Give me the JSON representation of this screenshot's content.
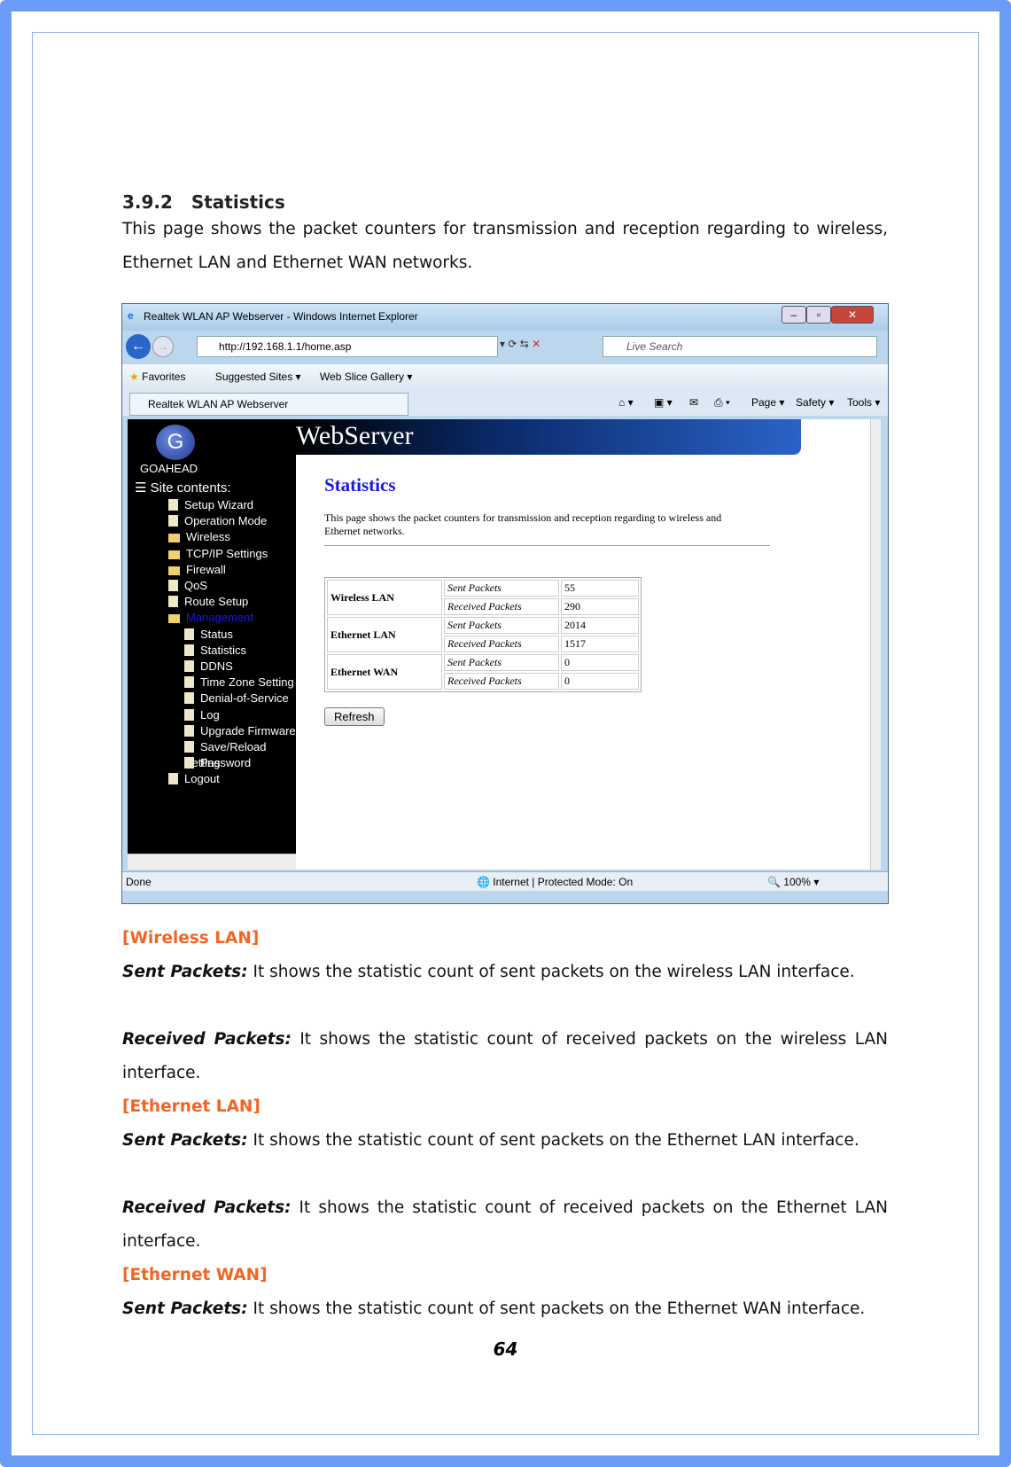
{
  "section": {
    "number": "3.9.2",
    "title": "Statistics",
    "intro": "This page shows the packet counters for transmission and reception regarding to wireless, Ethernet LAN and Ethernet WAN networks."
  },
  "browser": {
    "window_title": "Realtek WLAN AP Webserver - Windows Internet Explorer",
    "url": "http://192.168.1.1/home.asp",
    "search_placeholder": "Live Search",
    "favorites": "Favorites",
    "suggested": "Suggested Sites ▾",
    "webslice": "Web Slice Gallery ▾",
    "tab": "Realtek WLAN AP Webserver",
    "cmd": {
      "page": "Page ▾",
      "safety": "Safety ▾",
      "tools": "Tools ▾"
    },
    "status": {
      "left": "Done",
      "zone": "Internet | Protected Mode: On",
      "zoom": "100%"
    }
  },
  "site": {
    "logo": "GOAHEAD",
    "banner": "WebServer",
    "site_contents": "Site contents:",
    "menu": [
      {
        "label": "Setup Wizard",
        "type": "page",
        "level": 0
      },
      {
        "label": "Operation Mode",
        "type": "page",
        "level": 0
      },
      {
        "label": "Wireless",
        "type": "folder",
        "level": 0
      },
      {
        "label": "TCP/IP Settings",
        "type": "folder",
        "level": 0
      },
      {
        "label": "Firewall",
        "type": "folder",
        "level": 0
      },
      {
        "label": "QoS",
        "type": "page",
        "level": 0
      },
      {
        "label": "Route Setup",
        "type": "page",
        "level": 0
      },
      {
        "label": "Management",
        "type": "folder-open",
        "level": 0
      },
      {
        "label": "Status",
        "type": "page",
        "level": 1
      },
      {
        "label": "Statistics",
        "type": "page",
        "level": 1
      },
      {
        "label": "DDNS",
        "type": "page",
        "level": 1
      },
      {
        "label": "Time Zone Setting",
        "type": "page",
        "level": 1
      },
      {
        "label": "Denial-of-Service",
        "type": "page",
        "level": 1
      },
      {
        "label": "Log",
        "type": "page",
        "level": 1
      },
      {
        "label": "Upgrade Firmware",
        "type": "page",
        "level": 1
      },
      {
        "label": "Save/Reload Setting",
        "type": "page",
        "level": 1
      },
      {
        "label": "Password",
        "type": "page",
        "level": 1
      },
      {
        "label": "Logout",
        "type": "page",
        "level": 0
      }
    ],
    "page_title": "Statistics",
    "page_desc": "This page shows the packet counters for transmission and reception regarding to wireless and Ethernet networks.",
    "table": [
      {
        "group": "Wireless LAN",
        "rows": [
          [
            "Sent Packets",
            "55"
          ],
          [
            "Received Packets",
            "290"
          ]
        ]
      },
      {
        "group": "Ethernet LAN",
        "rows": [
          [
            "Sent Packets",
            "2014"
          ],
          [
            "Received Packets",
            "1517"
          ]
        ]
      },
      {
        "group": "Ethernet WAN",
        "rows": [
          [
            "Sent Packets",
            "0"
          ],
          [
            "Received Packets",
            "0"
          ]
        ]
      }
    ],
    "refresh": "Refresh"
  },
  "descriptions": [
    {
      "heading": "[Wireless LAN]",
      "items": [
        {
          "term": "Sent Packets:",
          "text": " It shows the statistic count of sent packets on the wireless LAN interface."
        },
        {
          "term": "Received Packets:",
          "text": " It shows the statistic count of received packets on the wireless LAN interface."
        }
      ]
    },
    {
      "heading": "[Ethernet LAN]",
      "items": [
        {
          "term": "Sent Packets:",
          "text": " It shows the statistic count of sent packets on the Ethernet LAN interface."
        },
        {
          "term": "Received Packets:",
          "text": " It shows the statistic count of received packets on the Ethernet LAN interface."
        }
      ]
    },
    {
      "heading": "[Ethernet WAN]",
      "items": [
        {
          "term": "Sent Packets:",
          "text": " It shows the statistic count of sent packets on the Ethernet WAN interface."
        }
      ]
    }
  ],
  "page_number": "64",
  "colors": {
    "frame": "#6a9cf5",
    "heading_orange": "#f26522",
    "title_blue": "#1a1adf"
  }
}
